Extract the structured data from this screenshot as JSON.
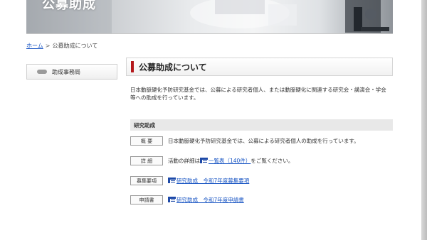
{
  "banner": {
    "title": "公募助成"
  },
  "breadcrumb": {
    "home": "ホーム",
    "separator": ">",
    "current": "公募助成について"
  },
  "sidebar": {
    "item_label": "助成事務局"
  },
  "main": {
    "heading": "公募助成について",
    "intro": "日本動脈硬化予防研究基金では、公募による研究者個人、または動脈硬化に関連する研究会・講演会・学会等への助成を行っています。",
    "section_title": "研究助成",
    "rows": [
      {
        "tag": "概 要",
        "text": "日本動脈硬化予防研究基金では、公募による研究者個人の助成を行っています。"
      },
      {
        "tag": "詳 細",
        "prefix": "活動の詳細は",
        "link": "一覧表（140件）",
        "suffix": "をご覧ください。"
      },
      {
        "tag": "募集要項",
        "link": "研究助成　令和7年度募集要項"
      },
      {
        "tag": "申請書",
        "link": "研究助成　令和7年度申請書"
      }
    ]
  },
  "colors": {
    "accent": "#b4181b",
    "link": "#1a56c4",
    "icon_blue": "#1e4aa8"
  },
  "icons": {
    "doc": "document-icon",
    "side": "pill-icon"
  }
}
